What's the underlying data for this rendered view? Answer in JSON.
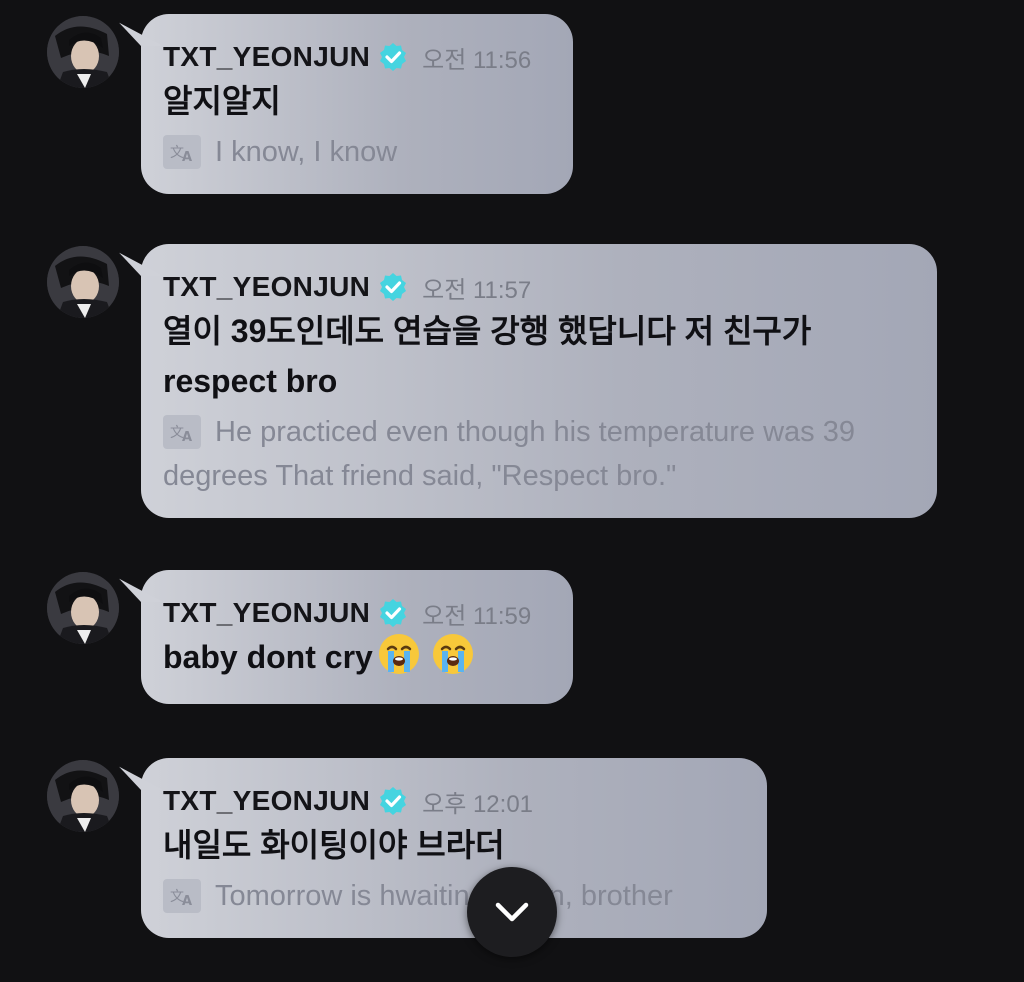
{
  "messages": [
    {
      "username": "TXT_YEONJUN",
      "time": "오전 11:56",
      "text": "알지알지",
      "translation": "I know, I know"
    },
    {
      "username": "TXT_YEONJUN",
      "time": "오전 11:57",
      "text_line1": "열이 39도인데도 연습을 강행 했답니다 저 친구가",
      "text_line2": "respect bro",
      "translation": "He practiced even though his temperature was 39 degrees That friend said, \"Respect bro.\""
    },
    {
      "username": "TXT_YEONJUN",
      "time": "오전 11:59",
      "text": "baby dont cry",
      "emojis": [
        "loudly-crying-face",
        "loudly-crying-face"
      ]
    },
    {
      "username": "TXT_YEONJUN",
      "time": "오후 12:01",
      "text": "내일도 화이팅이야 브라더",
      "translation": "Tomorrow is hwaiting again, brother"
    }
  ],
  "icons": {
    "verified": "verified-badge-icon",
    "translate": "translate-icon",
    "scroll_down": "chevron-down-icon"
  },
  "colors": {
    "background": "#111113",
    "verified": "#45d4e0",
    "bubble_light": "#cfd1d8",
    "bubble_dark": "#a3a7b6"
  }
}
